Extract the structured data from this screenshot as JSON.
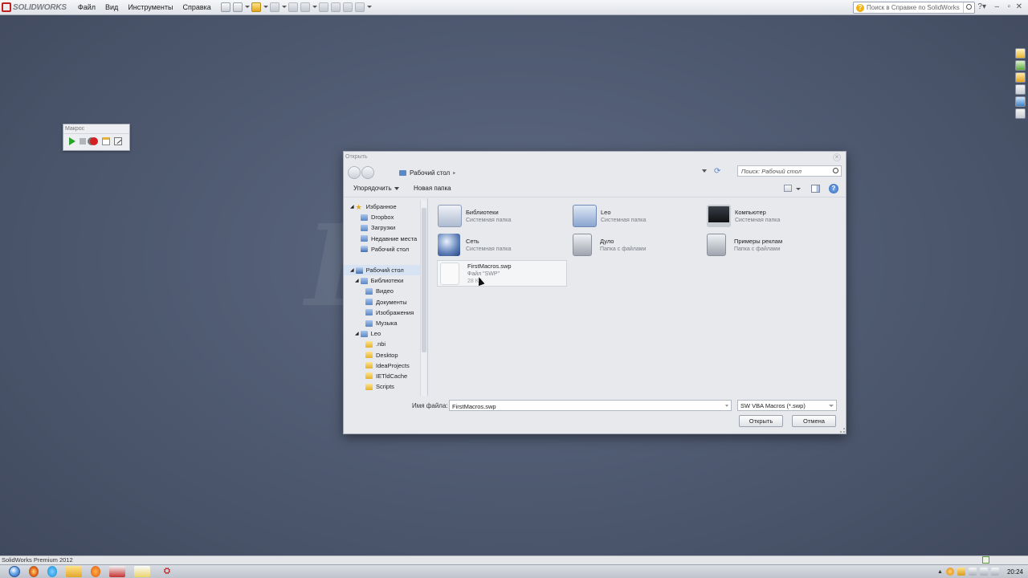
{
  "app": {
    "brand": "SOLIDWORKS",
    "menu": [
      "Файл",
      "Вид",
      "Инструменты",
      "Справка"
    ],
    "help_search_placeholder": "Поиск в Справке по SolidWorks",
    "status_text": "SolidWorks Premium 2012",
    "watermark": "D"
  },
  "macro_toolbar": {
    "title": "Макрос",
    "buttons": [
      "play-icon",
      "stop-icon",
      "record-icon",
      "new-macro-icon",
      "edit-macro-icon"
    ]
  },
  "dialog": {
    "title": "Открыть",
    "address": "Рабочий стол",
    "search_placeholder": "Поиск: Рабочий стол",
    "toolbar": {
      "organize": "Упорядочить",
      "new_folder": "Новая папка"
    },
    "nav": {
      "favorites_header": "Избранное",
      "favorites": [
        "Dropbox",
        "Загрузки",
        "Недавние места",
        "Рабочий стол"
      ],
      "desktop_header": "Рабочий стол",
      "libraries_header": "Библиотеки",
      "libraries": [
        "Видео",
        "Документы",
        "Изображения",
        "Музыка"
      ],
      "user_header": "Leo",
      "user_folders": [
        ".nbi",
        "Desktop",
        "IdeaProjects",
        "IETldCache",
        "Scripts"
      ]
    },
    "items": [
      {
        "name": "Библиотеки",
        "sub": "Системная папка",
        "icon": "libraries-icon"
      },
      {
        "name": "Leo",
        "sub": "Системная папка",
        "icon": "user-folder-icon"
      },
      {
        "name": "Компьютер",
        "sub": "Системная папка",
        "icon": "computer-icon"
      },
      {
        "name": "Сеть",
        "sub": "Системная папка",
        "icon": "network-icon"
      },
      {
        "name": "Дуло",
        "sub": "Папка с файлами",
        "icon": "folder-icon"
      },
      {
        "name": "Примеры реклам",
        "sub": "Папка с файлами",
        "icon": "folder-icon"
      },
      {
        "name": "FirstMacros.swp",
        "sub": "Файл \"SWP\"",
        "sub2": "28 КБ",
        "icon": "file-icon"
      }
    ],
    "filename_label": "Имя файла:",
    "filename_value": "FirstMacros.swp",
    "filetype": "SW VBA Macros (*.swp)",
    "open_button": "Открыть",
    "cancel_button": "Отмена"
  },
  "taskbar": {
    "clock": "20:24"
  },
  "colors": {
    "brand_red": "#c21f1f",
    "desktop_bg": "#4d586f",
    "dialog_bg": "#e7e9ed",
    "selection": "#d7e3f3"
  }
}
